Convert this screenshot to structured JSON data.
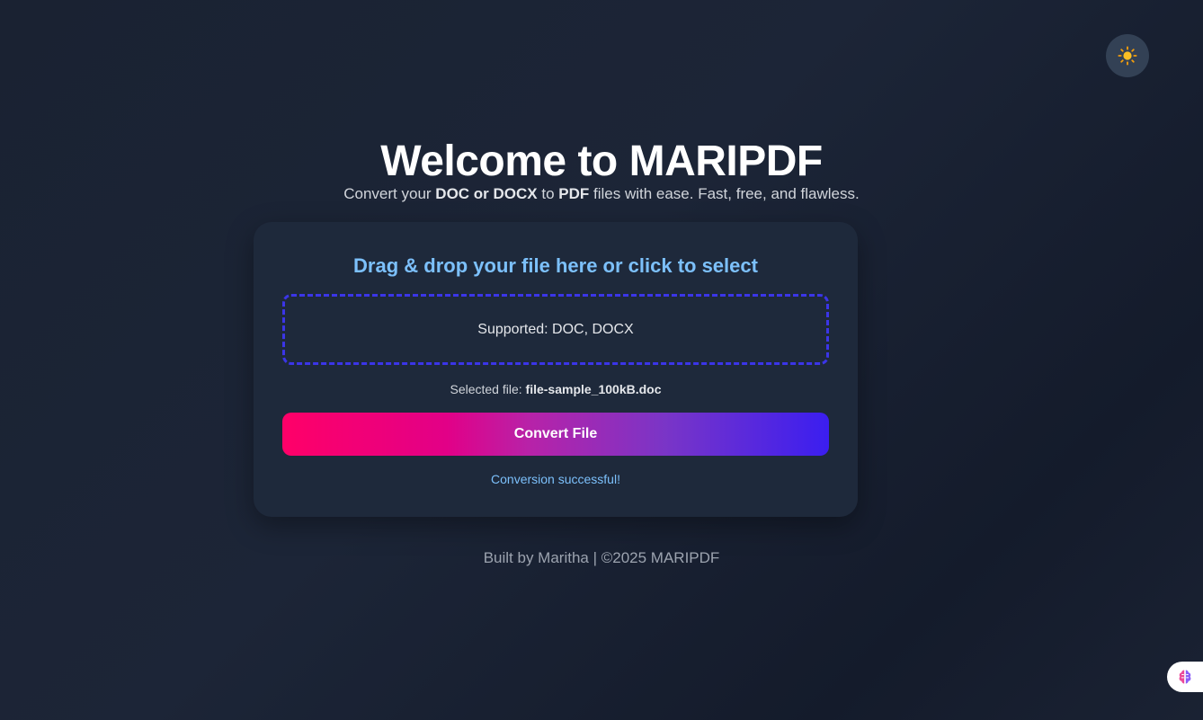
{
  "theme_toggle": {
    "icon": "sun-icon",
    "color": "#fbbf24"
  },
  "hero": {
    "title": "Welcome to MARIPDF",
    "subtitle": {
      "prefix": "Convert your ",
      "formats": "DOC or DOCX",
      "middle": " to ",
      "target": "PDF",
      "suffix": " files with ease. Fast, free, and flawless."
    }
  },
  "uploader": {
    "heading": "Drag & drop your file here or click to select",
    "supported": "Supported: DOC, DOCX",
    "selected_label": "Selected file: ",
    "selected_file": "file-sample_100kB.doc",
    "convert_label": "Convert File",
    "status": "Conversion successful!"
  },
  "footer": {
    "text": "Built by Maritha | ©2025 MARIPDF"
  },
  "colors": {
    "accent_blue": "#7cc0fb",
    "dropzone_border": "#3b35e8",
    "gradient_start": "#ff0068",
    "gradient_end": "#3b1ef0"
  },
  "floating_widget": {
    "icon": "brain-icon"
  }
}
